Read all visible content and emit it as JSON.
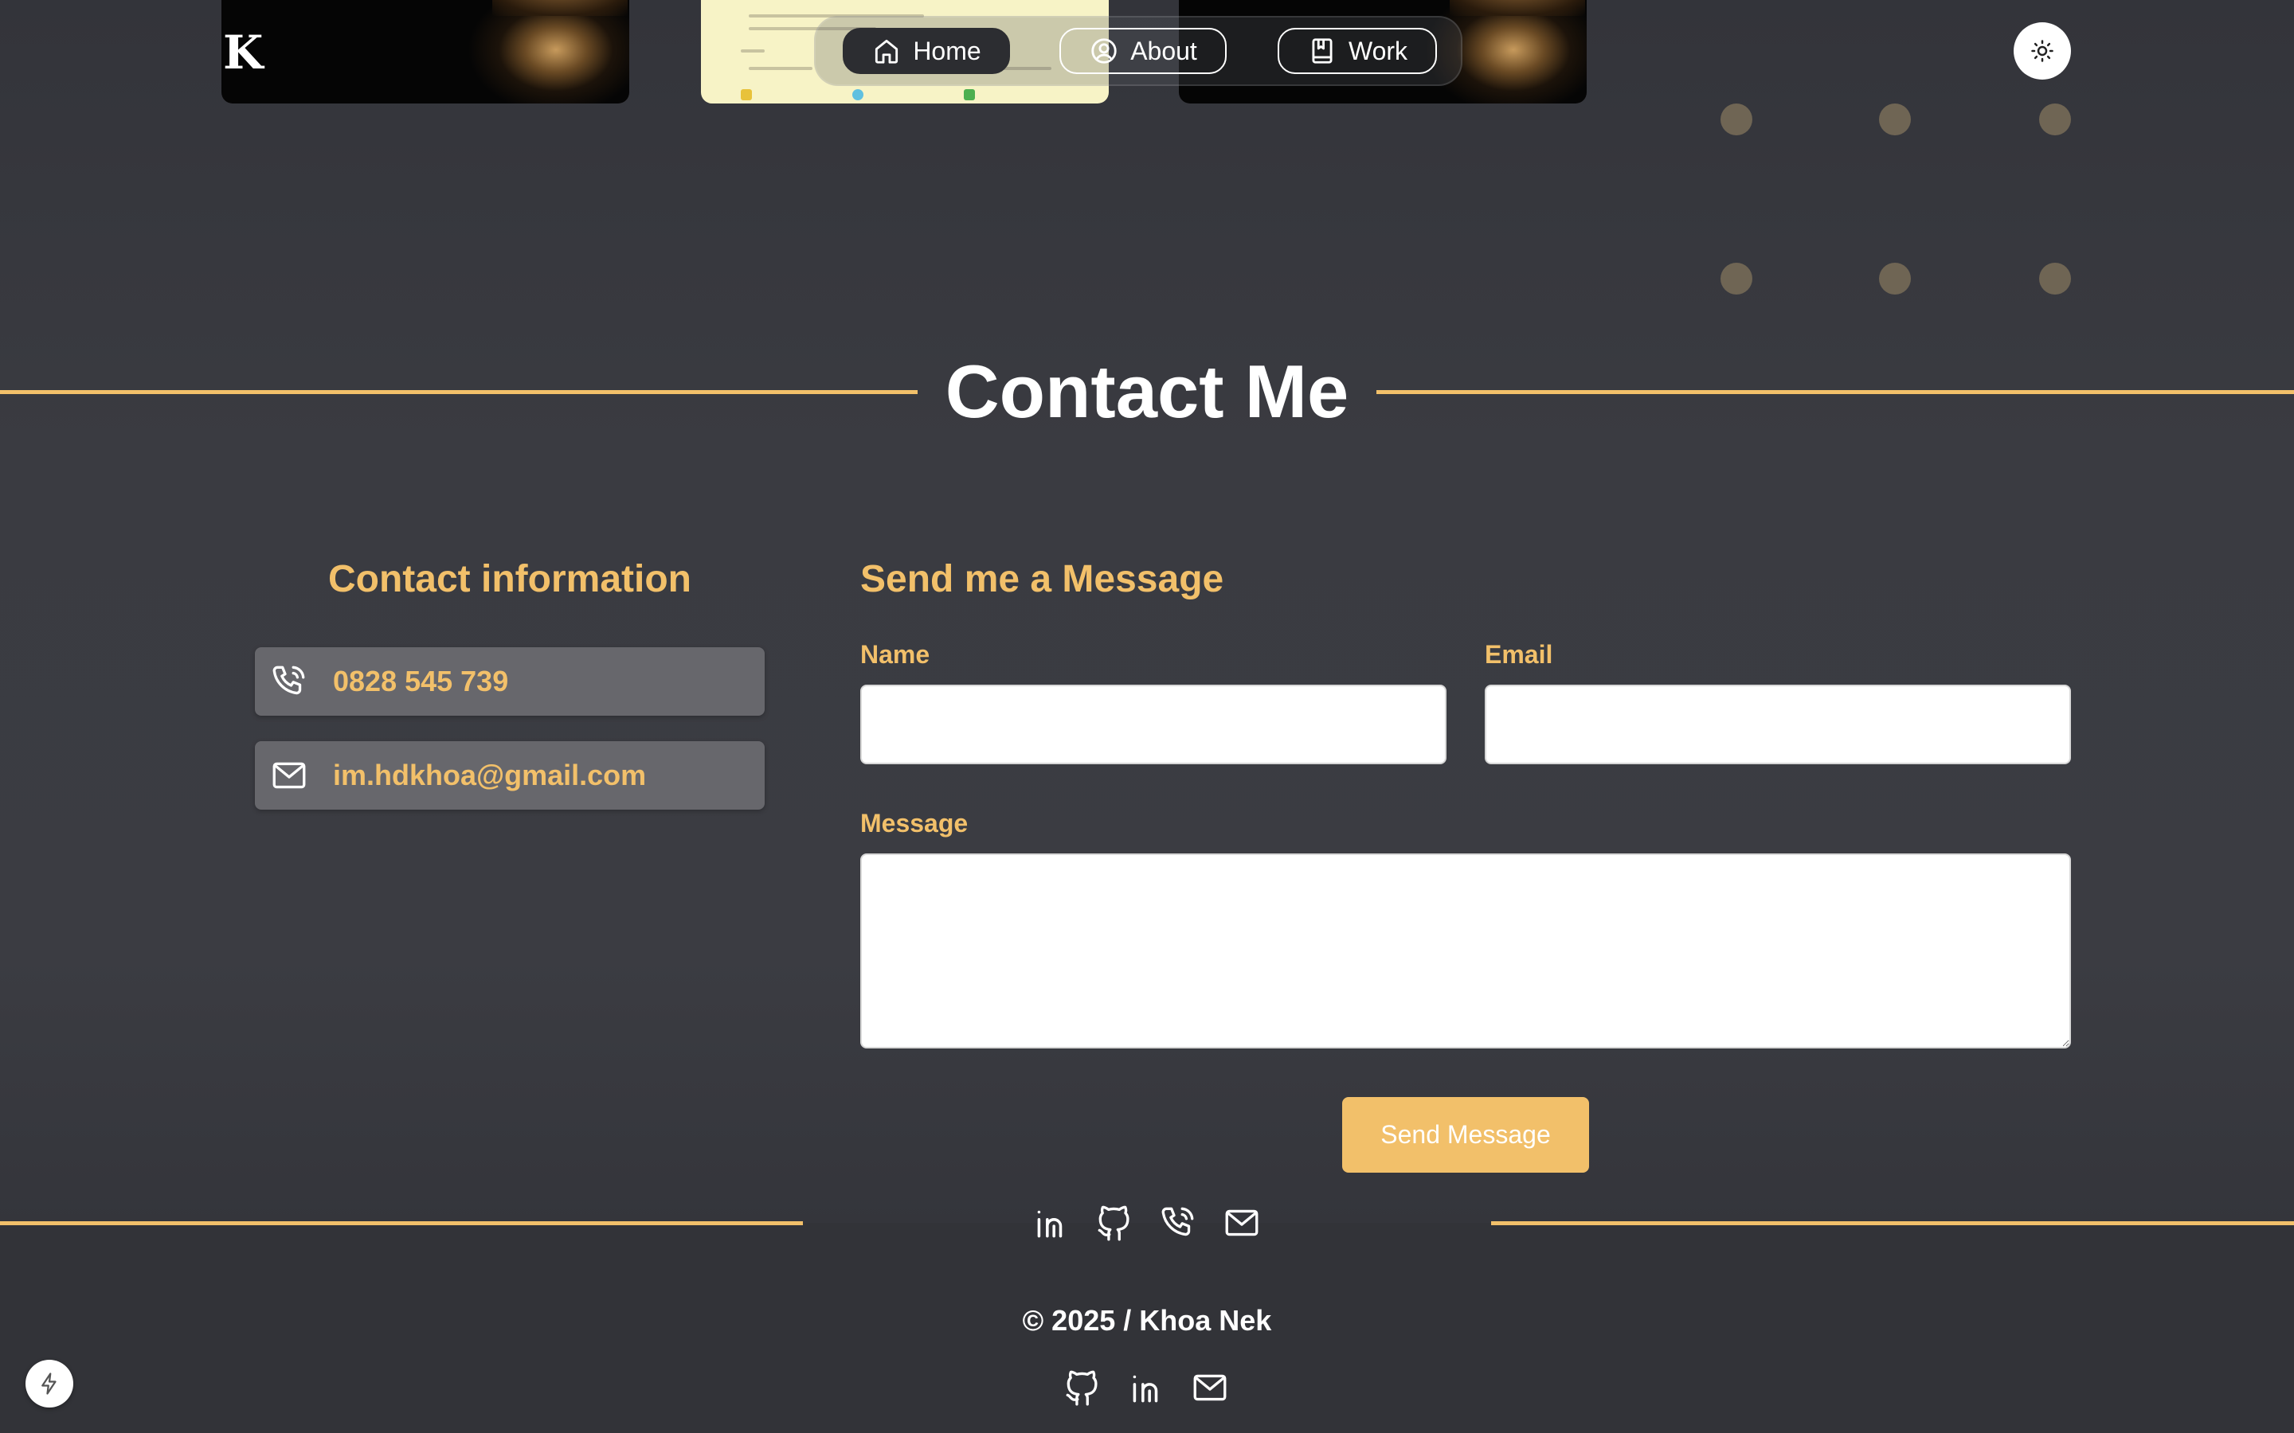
{
  "header": {
    "logo": "K",
    "nav": [
      {
        "label": "Home",
        "icon": "home-icon",
        "active": true
      },
      {
        "label": "About",
        "icon": "user-circle-icon",
        "active": false
      },
      {
        "label": "Work",
        "icon": "bookmark-book-icon",
        "active": false
      }
    ],
    "theme_toggle_icon": "sun-icon"
  },
  "contact_section": {
    "title": "Contact Me",
    "info": {
      "heading": "Contact information",
      "phone": "0828 545 739",
      "email": "im.hdkhoa@gmail.com"
    },
    "form": {
      "heading": "Send me a Message",
      "name_label": "Name",
      "name_value": "",
      "email_label": "Email",
      "email_value": "",
      "message_label": "Message",
      "message_value": "",
      "submit_label": "Send Message"
    }
  },
  "footer": {
    "social_top": [
      "linkedin-icon",
      "github-icon",
      "phone-icon",
      "mail-icon"
    ],
    "copyright": "© 2025 / Khoa Nek",
    "social_bottom": [
      "github-icon",
      "linkedin-icon",
      "mail-icon"
    ]
  },
  "colors": {
    "accent": "#f2c06a",
    "background": "#3a3b41",
    "card": "#67676c"
  }
}
